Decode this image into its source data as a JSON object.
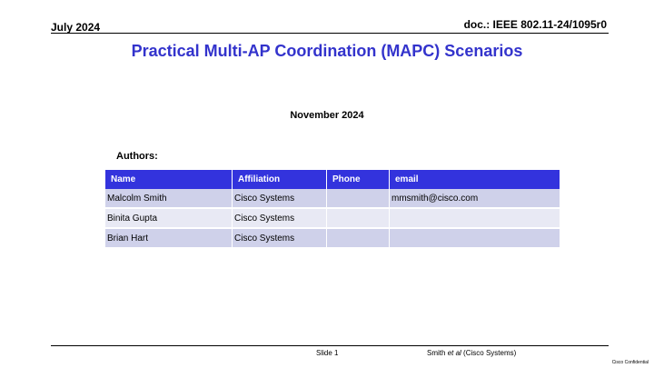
{
  "header": {
    "date": "July 2024",
    "doc": "doc.: IEEE 802.11-24/1095r0"
  },
  "title": "Practical Multi-AP Coordination (MAPC) Scenarios",
  "date": "November 2024",
  "authors_label": "Authors:",
  "authors_table": {
    "headers": [
      "Name",
      "Affiliation",
      "Phone",
      "email"
    ],
    "rows": [
      [
        "Malcolm Smith",
        "Cisco Systems",
        "",
        "mmsmith@cisco.com"
      ],
      [
        "Binita Gupta",
        "Cisco Systems",
        "",
        ""
      ],
      [
        "Brian Hart",
        "Cisco Systems",
        "",
        ""
      ]
    ]
  },
  "footer": {
    "slide": "Slide 1",
    "author_name": "Smith",
    "author_etal": "et al",
    "author_org": "(Cisco Systems)",
    "confidential": "Cisco Confidential"
  },
  "colors": {
    "title": "#3333cc",
    "table_header": "#3333dd",
    "row_odd": "#cfd1ea",
    "row_even": "#e8e9f4"
  }
}
